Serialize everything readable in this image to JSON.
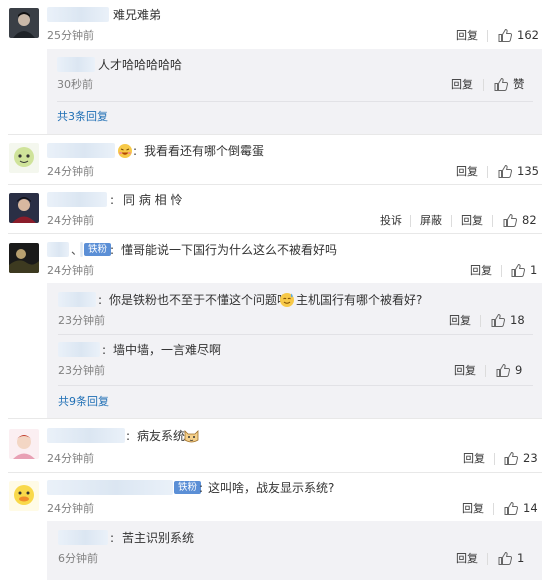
{
  "accent_link_color": "#1f6fb5",
  "badge_color": "#5b8fd6",
  "comments": [
    {
      "text": "难兄难弟",
      "time": "25分钟前",
      "reply_label": "回复",
      "likes": "162",
      "replies": [
        {
          "text": "人才哈哈哈哈哈",
          "time": "30秒前",
          "reply_label": "回复",
          "likes": "赞"
        }
      ],
      "more_replies": "共3条回复"
    },
    {
      "text": "我看看还有哪个倒霉蛋",
      "time": "24分钟前",
      "reply_label": "回复",
      "likes": "135",
      "emoji": "laughing-face-emoji"
    },
    {
      "text": "同 病 相 怜",
      "time": "24分钟前",
      "report_label": "投诉",
      "block_label": "屏蔽",
      "reply_label": "回复",
      "likes": "82"
    },
    {
      "text": "懂哥能说一下国行为什么这么不被看好吗",
      "time": "24分钟前",
      "badge": "铁粉",
      "name_mark": "、",
      "reply_label": "回复",
      "likes": "1",
      "replies": [
        {
          "text_before": "你是铁粉也不至于不懂这个问题吧",
          "text_after": "主机国行有哪个被看好?",
          "emoji": "sweat-smile-emoji",
          "time": "23分钟前",
          "reply_label": "回复",
          "likes": "18"
        },
        {
          "text": "墙中墙，一言难尽啊",
          "time": "23分钟前",
          "reply_label": "回复",
          "likes": "9"
        }
      ],
      "more_replies": "共9条回复"
    },
    {
      "text": "病友系统",
      "time": "24分钟前",
      "reply_label": "回复",
      "likes": "23",
      "emoji": "cat-face-emoji"
    },
    {
      "text": "这叫啥，战友显示系统?",
      "time": "24分钟前",
      "badge": "铁粉",
      "reply_label": "回复",
      "likes": "14",
      "replies": [
        {
          "text": "苦主识别系统",
          "time": "6分钟前",
          "reply_label": "回复",
          "likes": "1"
        }
      ]
    }
  ]
}
